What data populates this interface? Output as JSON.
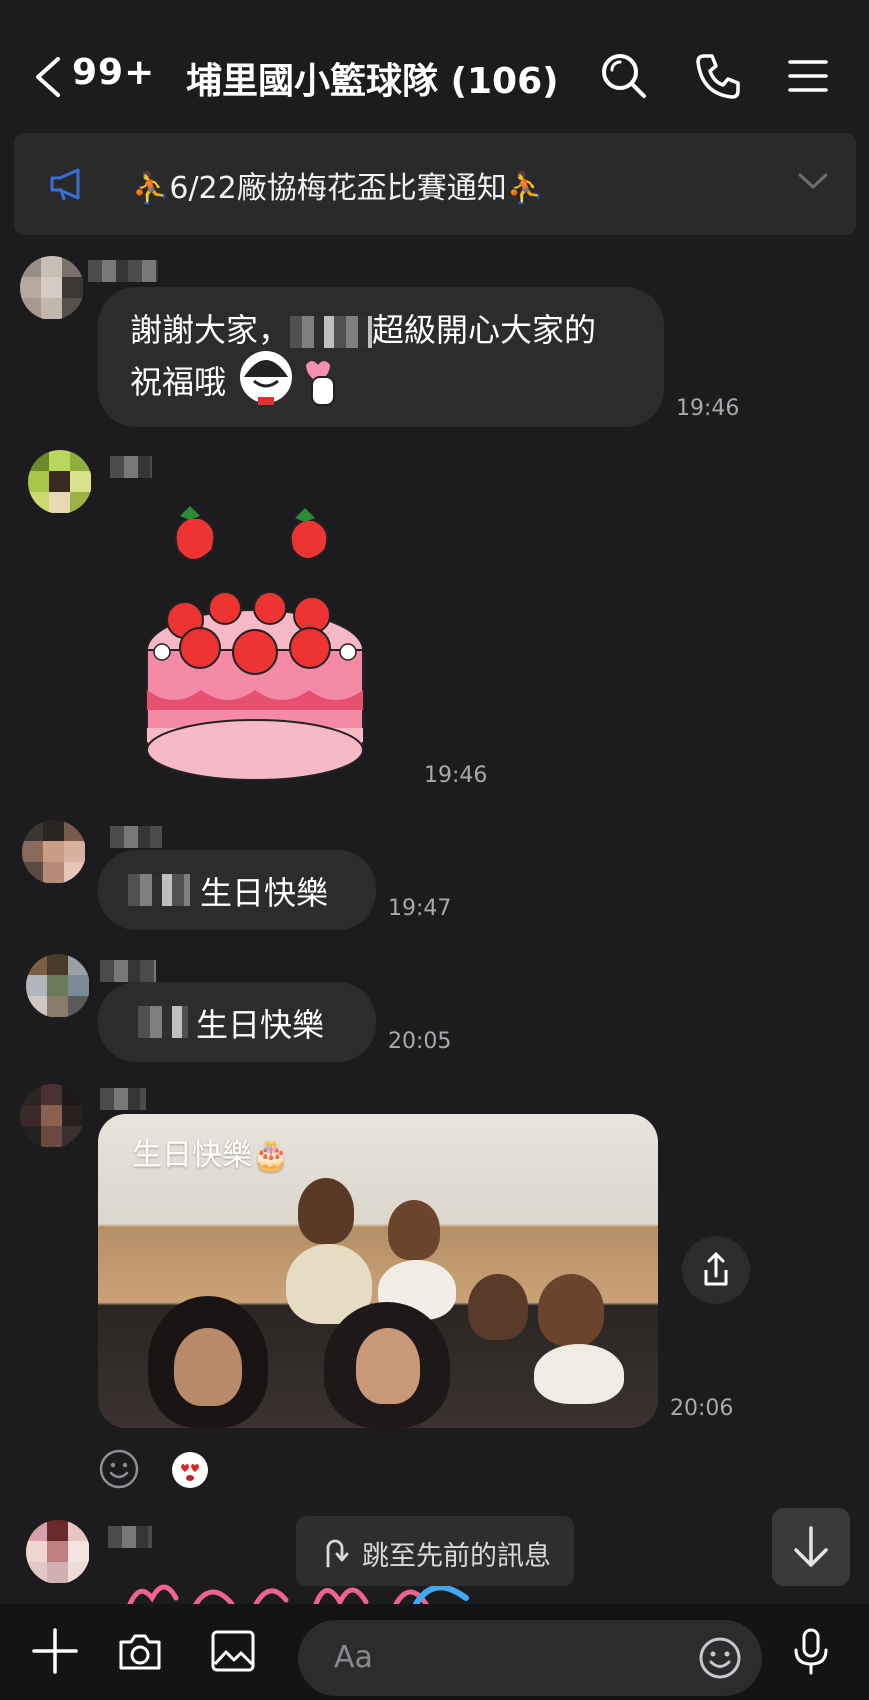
{
  "header": {
    "unread_count": "99+",
    "title": "埔里國小籃球隊 (106)"
  },
  "announcement": {
    "text": "⛹6/22廠協梅花盃比賽通知⛹"
  },
  "messages": [
    {
      "type": "text",
      "text_a": "謝謝大家，",
      "text_b": "超級開心大家的",
      "text_c": "祝福哦",
      "time": "19:46"
    },
    {
      "type": "sticker",
      "time": "19:46"
    },
    {
      "type": "text",
      "text": "生日快樂",
      "time": "19:47"
    },
    {
      "type": "text",
      "text": "生日快樂",
      "time": "20:05"
    },
    {
      "type": "photo",
      "caption": "生日快樂🎂",
      "time": "20:06"
    }
  ],
  "jump_button": {
    "label": "跳至先前的訊息"
  },
  "composer": {
    "placeholder": "Aa"
  },
  "colors": {
    "background": "#1c1c1e",
    "bubble": "#2c2c2e",
    "accent_blue": "#3b6fd8"
  },
  "icons": [
    "back-icon",
    "search-icon",
    "phone-icon",
    "menu-icon",
    "megaphone-icon",
    "chevron-down-icon",
    "share-icon",
    "smiley-icon",
    "jump-icon",
    "arrow-down-icon",
    "plus-icon",
    "camera-icon",
    "image-icon",
    "emoji-icon",
    "mic-icon"
  ]
}
